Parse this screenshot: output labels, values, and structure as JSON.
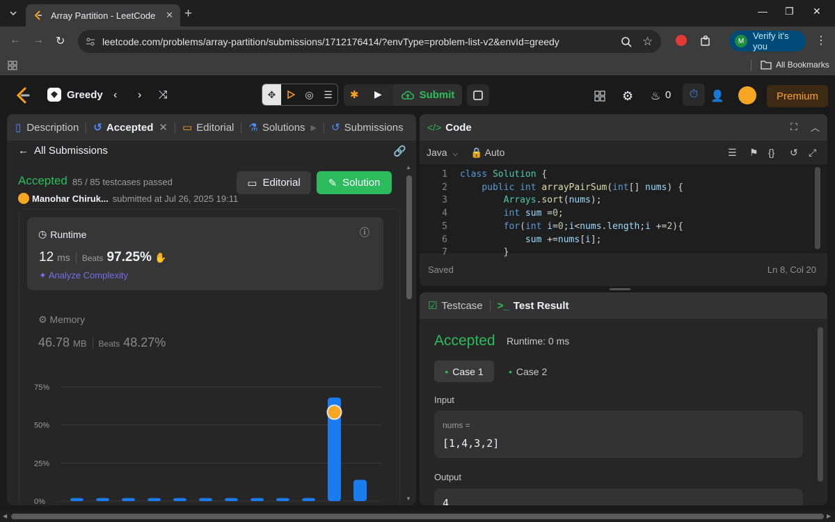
{
  "browser": {
    "tab_title": "Array Partition - LeetCode",
    "url": "leetcode.com/problems/array-partition/submissions/1712176414/?envType=problem-list-v2&envId=greedy",
    "verify_label": "Verify it's you",
    "profile_initial": "M",
    "bookmarks_label": "All Bookmarks"
  },
  "nav": {
    "problem_list": "Greedy",
    "submit_label": "Submit",
    "streak_count": "0",
    "premium_label": "Premium"
  },
  "left_panel": {
    "tabs": [
      "Description",
      "Accepted",
      "Editorial",
      "Solutions",
      "Submissions"
    ],
    "back_label": "All Submissions",
    "status": "Accepted",
    "testcases": "85 / 85 testcases passed",
    "user": "Manohar Chiruk...",
    "submitted": "submitted at Jul 26, 2025 19:11",
    "editorial_btn": "Editorial",
    "solution_btn": "Solution",
    "runtime": {
      "title": "Runtime",
      "value": "12",
      "unit": "ms",
      "beats_label": "Beats",
      "beats": "97.25%",
      "analyze": "Analyze Complexity"
    },
    "memory": {
      "title": "Memory",
      "value": "46.78",
      "unit": "MB",
      "beats_label": "Beats",
      "beats": "48.27%"
    }
  },
  "chart_data": {
    "type": "bar",
    "y_ticks": [
      "75%",
      "50%",
      "25%",
      "0%"
    ],
    "ylim": [
      0,
      75
    ],
    "values": [
      2,
      2,
      2,
      2,
      2,
      2,
      2,
      2,
      2,
      2,
      68,
      14
    ],
    "highlight_index": 10,
    "colors": {
      "bar": "#1b7cf0"
    }
  },
  "code_panel": {
    "title": "Code",
    "language": "Java",
    "mode": "Auto",
    "line_numbers": [
      "1",
      "2",
      "3",
      "4",
      "5",
      "6",
      "7"
    ],
    "saved": "Saved",
    "cursor": "Ln 8, Col 20"
  },
  "result_panel": {
    "tab_testcase": "Testcase",
    "tab_result": "Test Result",
    "status": "Accepted",
    "runtime": "Runtime: 0 ms",
    "case1": "Case 1",
    "case2": "Case 2",
    "input_label": "Input",
    "input_var": "nums =",
    "input_value": "[1,4,3,2]",
    "output_label": "Output",
    "output_value": "4"
  },
  "colors": {
    "accepted": "#2cbb5d",
    "brand_orange": "#ffa116",
    "panel": "#262626"
  }
}
